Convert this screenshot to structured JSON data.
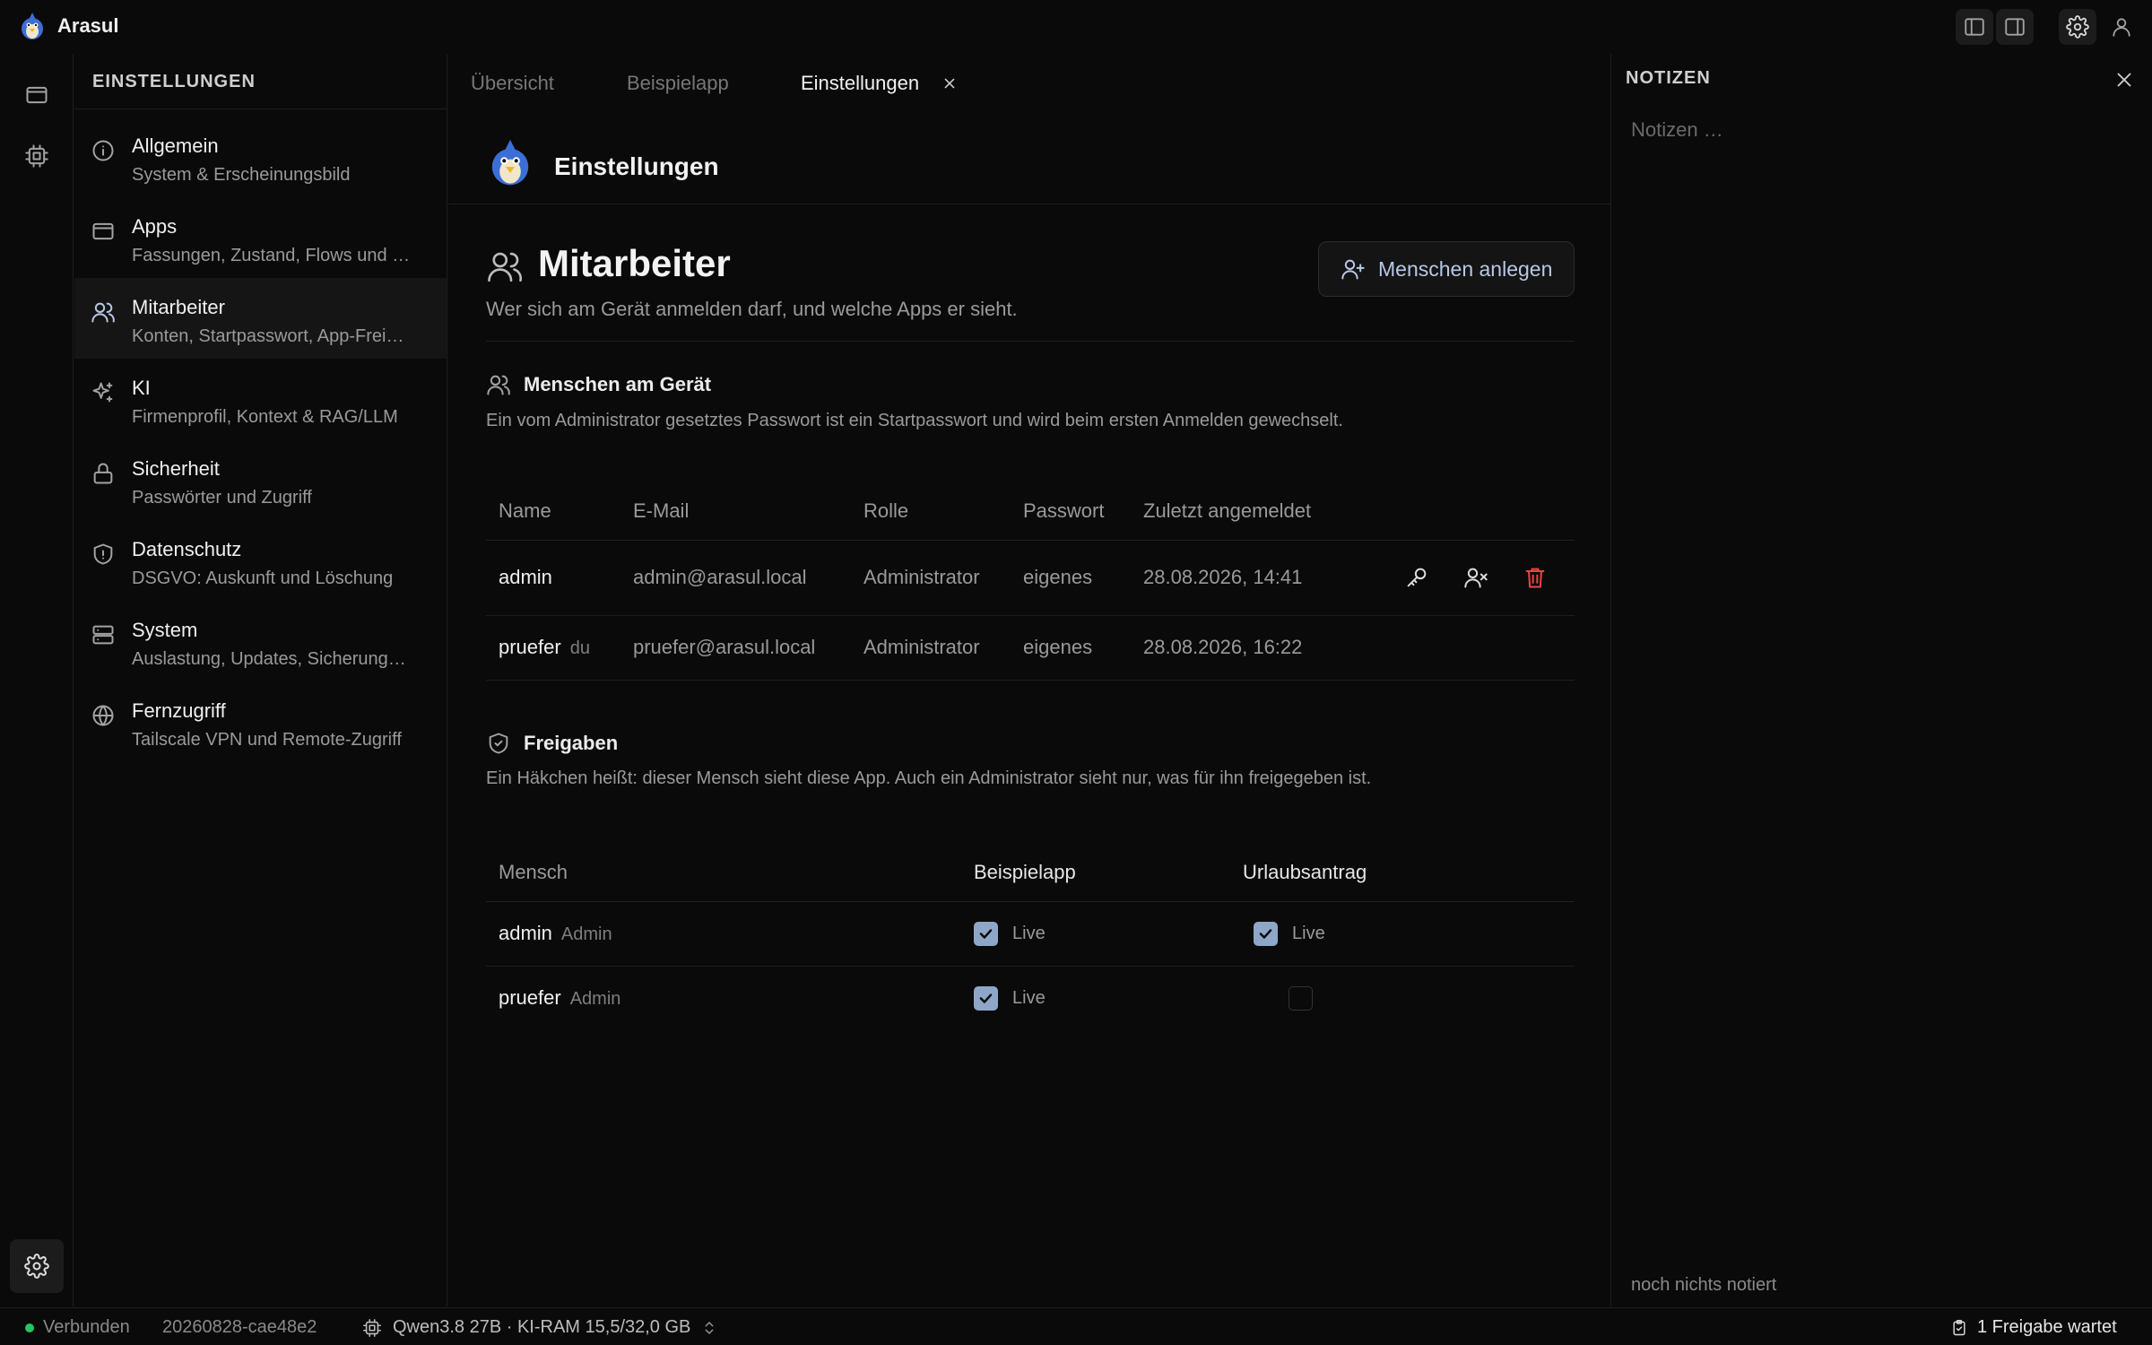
{
  "app": {
    "name": "Arasul"
  },
  "nav": {
    "heading": "EINSTELLUNGEN",
    "items": [
      {
        "title": "Allgemein",
        "subtitle": "System & Erscheinungsbild",
        "icon": "info-icon"
      },
      {
        "title": "Apps",
        "subtitle": "Fassungen, Zustand, Flows und …",
        "icon": "window-icon"
      },
      {
        "title": "Mitarbeiter",
        "subtitle": "Konten, Startpasswort, App-Frei…",
        "icon": "users-icon"
      },
      {
        "title": "KI",
        "subtitle": "Firmenprofil, Kontext & RAG/LLM",
        "icon": "sparkles-icon"
      },
      {
        "title": "Sicherheit",
        "subtitle": "Passwörter und Zugriff",
        "icon": "lock-icon"
      },
      {
        "title": "Datenschutz",
        "subtitle": "DSGVO: Auskunft und Löschung",
        "icon": "shield-icon"
      },
      {
        "title": "System",
        "subtitle": "Auslastung, Updates, Sicherung…",
        "icon": "server-icon"
      },
      {
        "title": "Fernzugriff",
        "subtitle": "Tailscale VPN und Remote-Zugriff",
        "icon": "globe-icon"
      }
    ]
  },
  "tabs": [
    {
      "label": "Übersicht"
    },
    {
      "label": "Beispielapp"
    },
    {
      "label": "Einstellungen"
    }
  ],
  "page": {
    "app_title": "Einstellungen",
    "section_title": "Mitarbeiter",
    "section_subtitle": "Wer sich am Gerät anmelden darf, und welche Apps er sieht.",
    "add_button": "Menschen anlegen"
  },
  "people": {
    "title": "Menschen am Gerät",
    "description": "Ein vom Administrator gesetztes Passwort ist ein Startpasswort und wird beim ersten Anmelden gewechselt.",
    "columns": [
      "Name",
      "E-Mail",
      "Rolle",
      "Passwort",
      "Zuletzt angemeldet"
    ],
    "rows": [
      {
        "name": "admin",
        "tag": "",
        "email": "admin@arasul.local",
        "role": "Administrator",
        "password": "eigenes",
        "last": "28.08.2026, 14:41"
      },
      {
        "name": "pruefer",
        "tag": "du",
        "email": "pruefer@arasul.local",
        "role": "Administrator",
        "password": "eigenes",
        "last": "28.08.2026, 16:22"
      }
    ]
  },
  "grants": {
    "title": "Freigaben",
    "description": "Ein Häkchen heißt: dieser Mensch sieht diese App. Auch ein Administrator sieht nur, was für ihn freigegeben ist.",
    "columns": [
      "Mensch",
      "Beispielapp",
      "Urlaubsantrag"
    ],
    "rows": [
      {
        "name": "admin",
        "tag": "Admin",
        "app1": {
          "checked": true,
          "label": "Live"
        },
        "app2": {
          "checked": true,
          "label": "Live"
        }
      },
      {
        "name": "pruefer",
        "tag": "Admin",
        "app1": {
          "checked": true,
          "label": "Live"
        },
        "app2": {
          "checked": false,
          "label": ""
        }
      }
    ]
  },
  "notes": {
    "heading": "NOTIZEN",
    "placeholder": "Notizen …",
    "empty": "noch nichts notiert"
  },
  "status": {
    "connection": "Verbunden",
    "build": "20260828-cae48e2",
    "model": "Qwen3.8 27B · KI-RAM 15,5/32,0 GB",
    "pending": "1 Freigabe wartet"
  },
  "colors": {
    "accent": "#8ea6c8",
    "danger": "#ef4444",
    "online": "#22c55e"
  }
}
